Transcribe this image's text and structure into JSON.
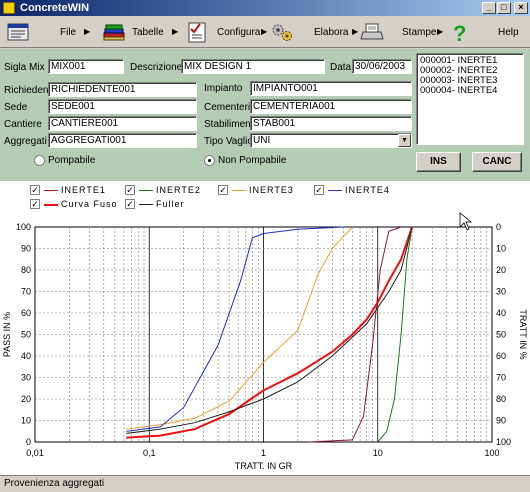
{
  "window": {
    "title": "ConcreteWIN"
  },
  "toolbar": {
    "file": "File",
    "tabelle": "Tabelle",
    "configura": "Configura",
    "elabora": "Elabora",
    "stampe": "Stampe",
    "help": "Help"
  },
  "form": {
    "sigla_mix_label": "Sigla Mix",
    "sigla_mix": "MIX001",
    "descrizione_label": "Descrizione",
    "descrizione": "MIX DESIGN 1",
    "data_label": "Data",
    "data": "30/06/2003",
    "richiedente_label": "Richiedente",
    "richiedente": "RICHIEDENTE001",
    "sede_label": "Sede",
    "sede": "SEDE001",
    "cantiere_label": "Cantiere",
    "cantiere": "CANTIERE001",
    "aggregati_label": "Aggregati",
    "aggregati": "AGGREGATI001",
    "impianto_label": "Impianto",
    "impianto": "IMPIANTO001",
    "cementeria_label": "Cementeria",
    "cementeria": "CEMENTERIA001",
    "stabilimento_label": "Stabilimento",
    "stabilimento": "STAB001",
    "tipo_vaglio_label": "Tipo Vaglio",
    "tipo_vaglio": "UNI",
    "pompabile": "Pompabile",
    "non_pompabile": "Non Pompabile",
    "selected_pump": "Non Pompabile",
    "ins": "INS",
    "canc": "CANC"
  },
  "inerti_list": [
    "000001- INERTE1",
    "000002- INERTE2",
    "000003- INERTE3",
    "000004- INERTE4"
  ],
  "legend": [
    {
      "label": "INERTE1",
      "color": "#c01818",
      "checked": true
    },
    {
      "label": "INERTE2",
      "color": "#1a7a1a",
      "checked": true
    },
    {
      "label": "INERTE3",
      "color": "#f0a030",
      "checked": true
    },
    {
      "label": "INERTE4",
      "color": "#2030c8",
      "checked": true
    },
    {
      "label": "Curva Fuso",
      "color": "#ee1010",
      "checked": true
    },
    {
      "label": "Fuller",
      "color": "#202020",
      "checked": true
    }
  ],
  "chart_data": {
    "type": "line",
    "xlabel": "TRATT. IN GR",
    "ylabel_left": "PASS IN %",
    "ylabel_right": "TRATT IN %",
    "x_scale": "log",
    "xlim": [
      0.01,
      100
    ],
    "ylim": [
      0,
      100
    ],
    "x_ticks": [
      "0,01",
      "0,1",
      "1",
      "10",
      "100"
    ],
    "y_ticks_left": [
      "0",
      "10",
      "20",
      "30",
      "40",
      "50",
      "60",
      "70",
      "80",
      "90",
      "100"
    ],
    "y_ticks_right": [
      "100",
      "90",
      "80",
      "70",
      "60",
      "50",
      "40",
      "30",
      "20",
      "10",
      "0"
    ],
    "grid": true,
    "series": [
      {
        "name": "INERTE1",
        "color": "#8b1a3a",
        "points": [
          [
            2.5,
            0
          ],
          [
            6,
            1
          ],
          [
            7.5,
            12
          ],
          [
            9,
            45
          ],
          [
            10.5,
            80
          ],
          [
            12.5,
            98
          ],
          [
            16,
            100
          ]
        ]
      },
      {
        "name": "INERTE2",
        "color": "#1a7a1a",
        "points": [
          [
            10,
            0
          ],
          [
            12,
            5
          ],
          [
            14,
            20
          ],
          [
            16,
            50
          ],
          [
            18,
            85
          ],
          [
            20,
            100
          ]
        ]
      },
      {
        "name": "INERTE3",
        "color": "#f0a030",
        "points": [
          [
            0.063,
            6
          ],
          [
            0.125,
            8
          ],
          [
            0.25,
            11
          ],
          [
            0.5,
            19
          ],
          [
            1,
            37
          ],
          [
            2,
            52
          ],
          [
            3,
            78
          ],
          [
            4,
            90
          ],
          [
            6,
            100
          ]
        ]
      },
      {
        "name": "INERTE4",
        "color": "#2030c8",
        "points": [
          [
            0.063,
            5
          ],
          [
            0.125,
            7
          ],
          [
            0.2,
            16
          ],
          [
            0.4,
            45
          ],
          [
            0.63,
            75
          ],
          [
            0.8,
            95
          ],
          [
            1,
            97
          ],
          [
            2,
            99
          ],
          [
            5,
            100
          ]
        ]
      },
      {
        "name": "Curva Fuso",
        "color": "#ee1010",
        "width": 2,
        "points": [
          [
            0.063,
            2
          ],
          [
            0.125,
            3
          ],
          [
            0.25,
            6
          ],
          [
            0.5,
            13
          ],
          [
            1,
            24
          ],
          [
            2,
            32
          ],
          [
            4,
            42
          ],
          [
            6,
            50
          ],
          [
            8,
            57
          ],
          [
            10,
            65
          ],
          [
            12.5,
            75
          ],
          [
            16,
            85
          ],
          [
            20,
            100
          ]
        ]
      },
      {
        "name": "Fuller",
        "color": "#202020",
        "points": [
          [
            0.063,
            4
          ],
          [
            0.125,
            6
          ],
          [
            0.25,
            9
          ],
          [
            0.5,
            14
          ],
          [
            1,
            20
          ],
          [
            2,
            28
          ],
          [
            4,
            40
          ],
          [
            8,
            55
          ],
          [
            12.5,
            70
          ],
          [
            16,
            80
          ],
          [
            20,
            100
          ]
        ]
      }
    ]
  },
  "status": {
    "text": "Provenienza aggregati"
  }
}
